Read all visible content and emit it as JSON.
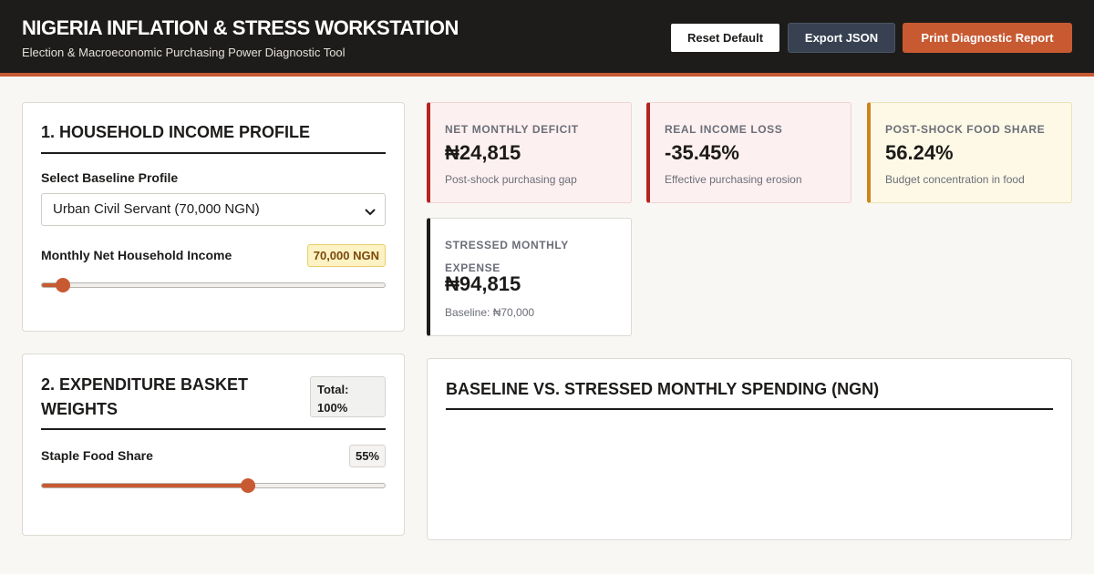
{
  "header": {
    "title": "NIGERIA INFLATION & STRESS WORKSTATION",
    "subtitle": "Election & Macroeconomic Purchasing Power Diagnostic Tool",
    "buttons": {
      "reset": "Reset Default",
      "export": "Export JSON",
      "print": "Print Diagnostic Report"
    }
  },
  "income_panel": {
    "title": "1. HOUSEHOLD INCOME PROFILE",
    "profile_label": "Select Baseline Profile",
    "profile_value": "Urban Civil Servant (70,000 NGN)",
    "income_label": "Monthly Net Household Income",
    "income_display": "70,000 NGN",
    "income_slider_fraction": 0.06
  },
  "basket_panel": {
    "title": "2. EXPENDITURE BASKET WEIGHTS",
    "total_label": "Total:",
    "total_value": "100%",
    "staple_label": "Staple Food Share",
    "staple_display": "55%",
    "staple_slider_fraction": 0.6
  },
  "kpis": {
    "deficit": {
      "label": "NET MONTHLY DEFICIT",
      "value": "₦24,815",
      "sub": "Post-shock purchasing gap"
    },
    "loss": {
      "label": "REAL INCOME LOSS",
      "value": "-35.45%",
      "sub": "Effective purchasing erosion"
    },
    "food": {
      "label": "POST-SHOCK FOOD SHARE",
      "value": "56.24%",
      "sub": "Budget concentration in food"
    },
    "stress": {
      "label": "STRESSED MONTHLY EXPENSE",
      "value": "₦94,815",
      "sub": "Baseline: ₦70,000"
    }
  },
  "chart_panel": {
    "title": "BASELINE VS. STRESSED MONTHLY SPENDING (NGN)"
  },
  "colors": {
    "accent": "#c85a32",
    "header_bg": "#1e1c1a",
    "danger": "#b3261e",
    "warning": "#d08419"
  },
  "icons": {
    "select_arrow": "chevron-down-icon"
  }
}
